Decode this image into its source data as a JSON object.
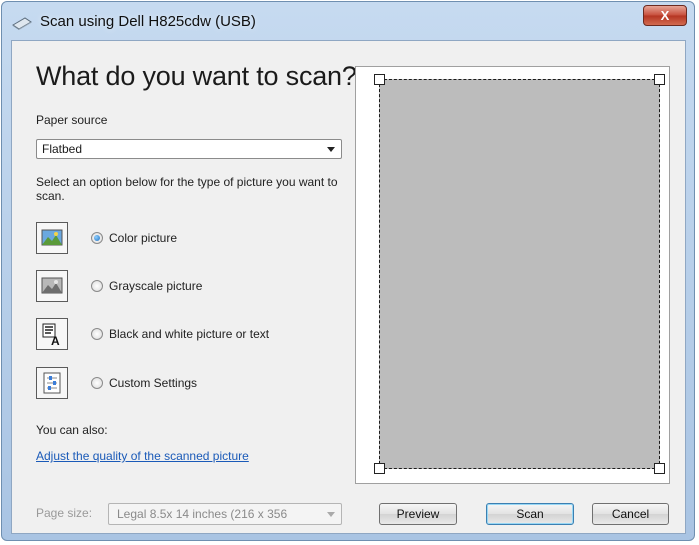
{
  "window": {
    "title": "Scan using Dell H825cdw (USB)",
    "close_label": "X"
  },
  "main": {
    "heading": "What do you want to scan?",
    "paper_source_label": "Paper source",
    "paper_source_value": "Flatbed",
    "instruction": "Select an option below for the type of picture you want to scan.",
    "options": [
      {
        "label": "Color picture",
        "checked": true,
        "icon": "color-picture-icon"
      },
      {
        "label": "Grayscale picture",
        "checked": false,
        "icon": "grayscale-picture-icon"
      },
      {
        "label": "Black and white picture or text",
        "checked": false,
        "icon": "black-white-text-icon"
      },
      {
        "label": "Custom Settings",
        "checked": false,
        "icon": "custom-settings-icon"
      }
    ],
    "also_label": "You can also:",
    "adjust_link": "Adjust the quality of the scanned picture"
  },
  "footer": {
    "page_size_label": "Page size:",
    "page_size_value": "Legal 8.5x 14 inches (216 x 356",
    "preview_button": "Preview",
    "scan_button": "Scan",
    "cancel_button": "Cancel"
  },
  "colors": {
    "link": "#1a5ab8",
    "scan_region": "#bcbcbc"
  }
}
